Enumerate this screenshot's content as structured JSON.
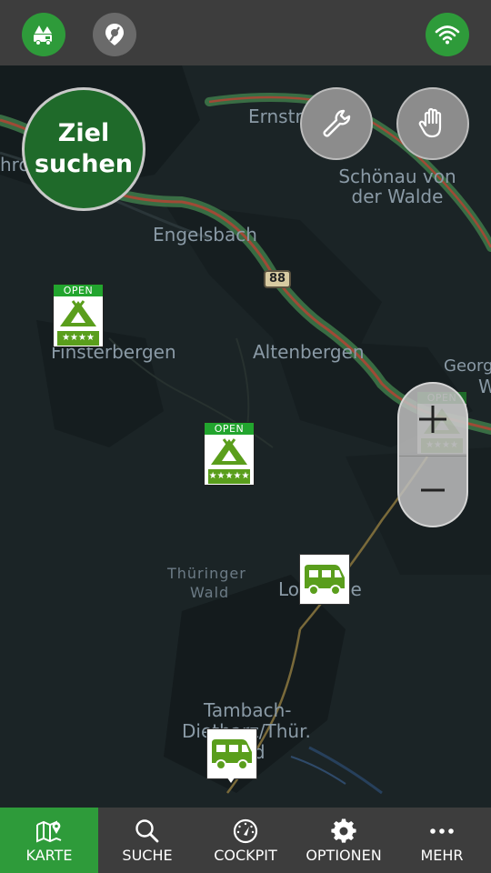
{
  "topbar": {
    "camper_mode_icon": "camper-mode-icon",
    "location_icon": "location-pin-icon",
    "wifi_icon": "wifi-icon"
  },
  "map": {
    "places": {
      "ernstroda": "Ernstroda",
      "schoenau": "Schönau von der Walde",
      "engelsbach": "Engelsbach",
      "finsterbergen": "Finsterbergen",
      "altenbergen": "Altenbergen",
      "thueringer_wald_1": "Thüringer",
      "thueringer_wald_2": "Wald",
      "lo_le": "Lo        le",
      "tambach_1": "Tambach-",
      "tambach_2": "Dietharz/Thür.",
      "tambach_3": "        d",
      "schroda": "hroda",
      "georgen": "Georgen",
      "w": "W"
    },
    "route_number": "88",
    "search_button": "Ziel suchen",
    "camp_open_label": "OPEN",
    "camp_stars_4": "★★★★",
    "camp_stars_5": "★★★★★",
    "colors": {
      "accent": "#2e9b3a",
      "road": "#a04a36",
      "road_glow": "#3e7a4a"
    }
  },
  "bottomnav": {
    "items": [
      {
        "label": "KARTE",
        "icon": "map-icon"
      },
      {
        "label": "SUCHE",
        "icon": "search-icon"
      },
      {
        "label": "COCKPIT",
        "icon": "speedometer-icon"
      },
      {
        "label": "OPTIONEN",
        "icon": "gear-icon"
      },
      {
        "label": "MEHR",
        "icon": "more-dots-icon"
      }
    ]
  }
}
